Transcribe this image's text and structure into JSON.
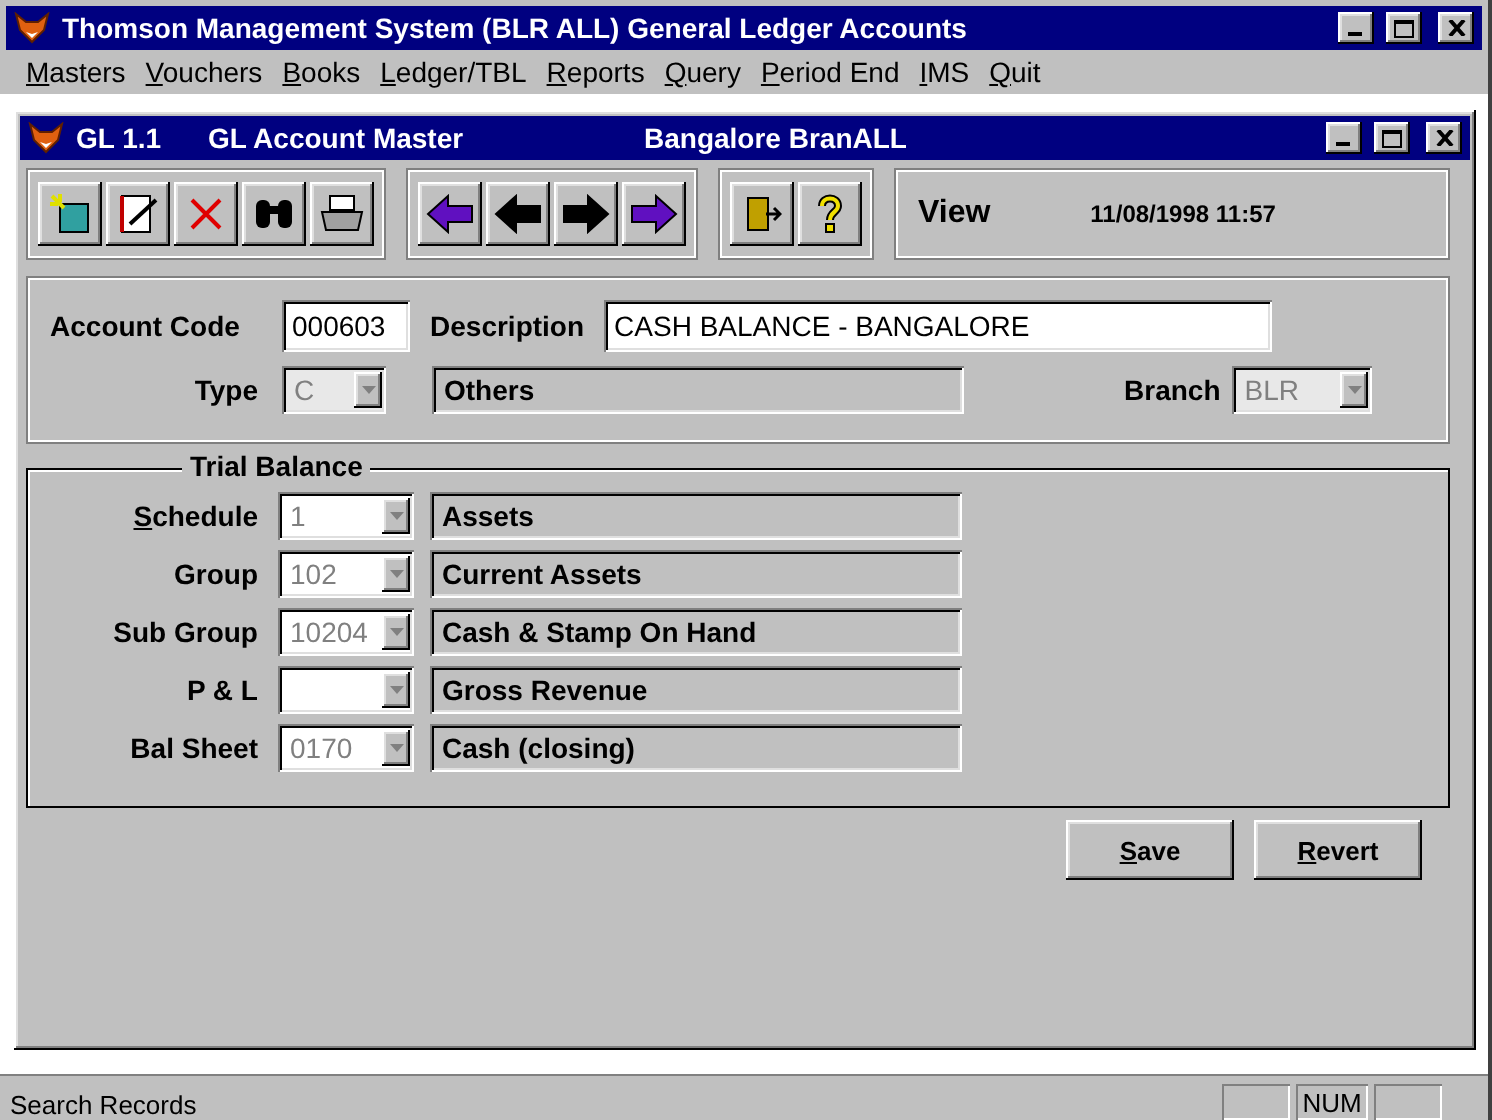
{
  "app_window": {
    "title": "Thomson Management System (BLR ALL) General Ledger Accounts"
  },
  "menu": [
    {
      "label": "Masters"
    },
    {
      "label": "Vouchers"
    },
    {
      "label": "Books"
    },
    {
      "label": "Ledger/TBL"
    },
    {
      "label": "Reports"
    },
    {
      "label": "Query"
    },
    {
      "label": "Period End"
    },
    {
      "label": "IMS"
    },
    {
      "label": "Quit"
    }
  ],
  "child_window": {
    "code": "GL 1.1",
    "title": "GL Account Master",
    "branch_title": "Bangalore BranALL"
  },
  "toolbar": {
    "mode": "View",
    "timestamp": "11/08/1998 11:57"
  },
  "account": {
    "code_label": "Account Code",
    "code": "000603",
    "description_label": "Description",
    "description": "CASH BALANCE - BANGALORE",
    "type_label": "Type",
    "type": "C",
    "type_name": "Others",
    "branch_label": "Branch",
    "branch": "BLR"
  },
  "trial_balance": {
    "title": "Trial Balance",
    "rows": [
      {
        "label": "Schedule",
        "mnemonic": true,
        "code": "1",
        "name": "Assets"
      },
      {
        "label": "Group",
        "mnemonic": false,
        "code": "102",
        "name": "Current Assets"
      },
      {
        "label": "Sub Group",
        "mnemonic": false,
        "code": "10204",
        "name": "Cash & Stamp On Hand"
      },
      {
        "label": "P & L",
        "mnemonic": false,
        "code": "",
        "name": "Gross Revenue"
      },
      {
        "label": "Bal Sheet",
        "mnemonic": false,
        "code": "0170",
        "name": "Cash (closing)"
      }
    ]
  },
  "buttons": [
    {
      "label": "Save"
    },
    {
      "label": "Revert"
    }
  ],
  "status_bar": {
    "message": "Search Records",
    "indicators": [
      "NUM"
    ]
  }
}
